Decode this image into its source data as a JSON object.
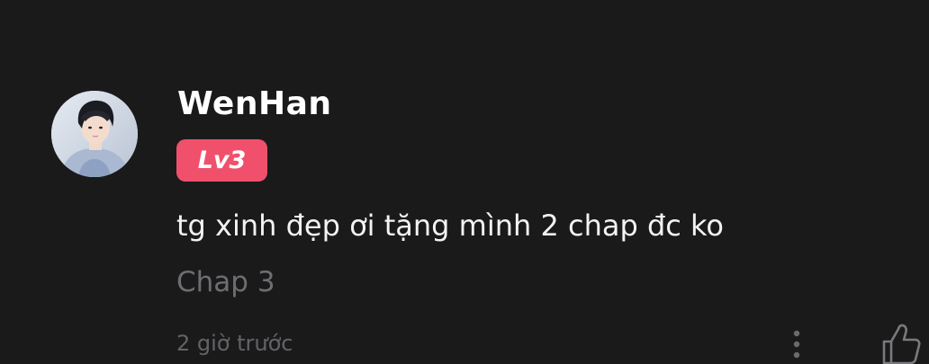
{
  "comment": {
    "author": {
      "username": "WenHan",
      "level_badge": "Lv3",
      "avatar": "avatar-photo"
    },
    "text": "tg xinh đẹp ơi tặng mình 2 chap đc ko",
    "chapter": "Chap 3",
    "timestamp": "2 giờ trước",
    "actions": {
      "more_icon": "more-vertical-icon",
      "like_icon": "thumbs-up-icon"
    }
  },
  "colors": {
    "background": "#1a1a1b",
    "username": "#ffffff",
    "badge": "#f0506b",
    "comment_text": "#f2f2f2",
    "muted_text": "#6e6e72"
  }
}
